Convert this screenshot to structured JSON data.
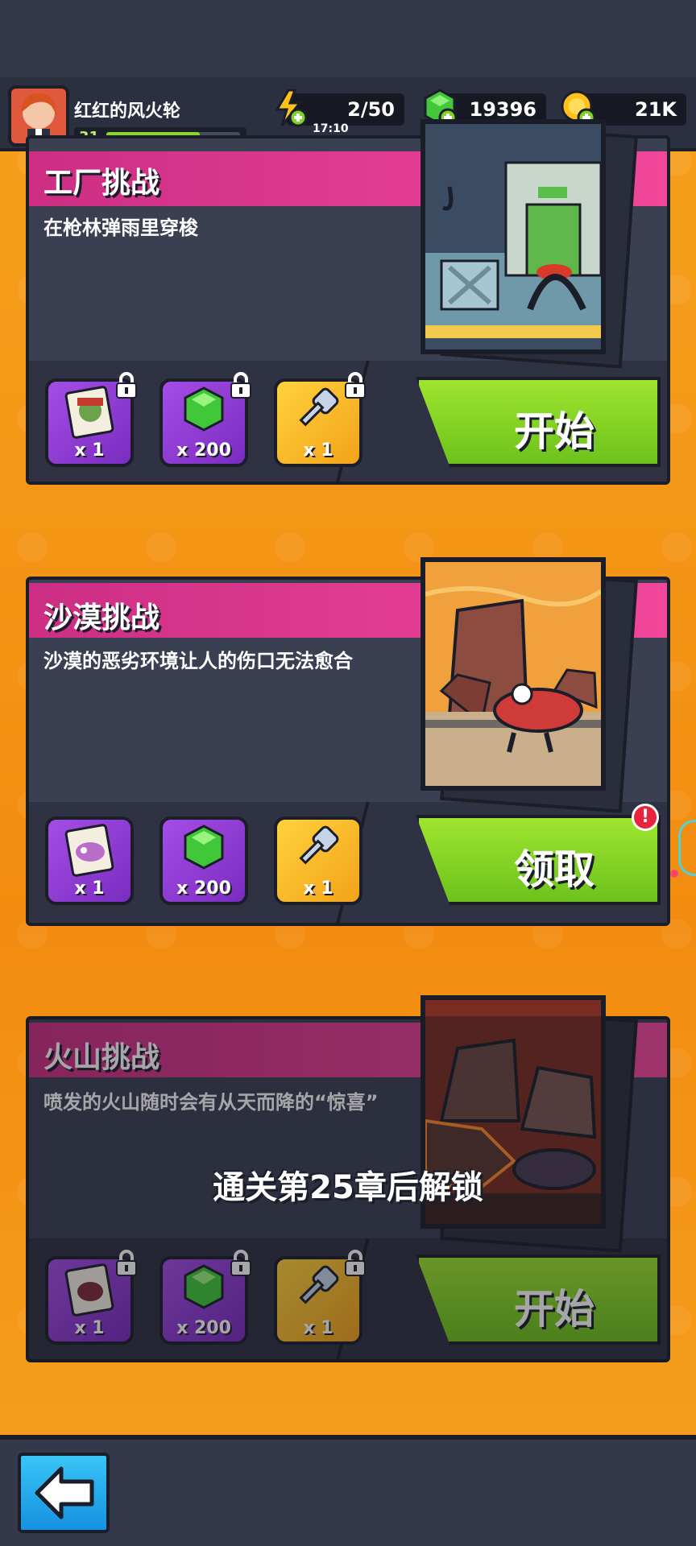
{
  "hud": {
    "player_name": "红红的风火轮",
    "level": "31",
    "xp_fraction": 0.7,
    "energy": "2/50",
    "energy_timer": "17:10",
    "gems": "19396",
    "coins": "21K"
  },
  "challenges": [
    {
      "title": "工厂挑战",
      "description": "在枪林弹雨里穿梭",
      "rewards": [
        {
          "icon": "zombie-card-icon",
          "qty": "x 1",
          "locked": true
        },
        {
          "icon": "green-gem-icon",
          "qty": "x 200",
          "locked": true
        },
        {
          "icon": "key-icon",
          "qty": "x 1",
          "locked": true
        }
      ],
      "button_label": "开始"
    },
    {
      "title": "沙漠挑战",
      "description": "沙漠的恶劣环境让人的伤口无法愈合",
      "rewards": [
        {
          "icon": "zombie-card-icon",
          "qty": "x 1",
          "locked": false
        },
        {
          "icon": "green-gem-icon",
          "qty": "x 200",
          "locked": false
        },
        {
          "icon": "key-icon",
          "qty": "x 1",
          "locked": false
        }
      ],
      "button_label": "领取",
      "alert": "!"
    },
    {
      "title": "火山挑战",
      "description": "喷发的火山随时会有从天而降的“惊喜”",
      "rewards": [
        {
          "icon": "zombie-card-icon",
          "qty": "x 1",
          "locked": true
        },
        {
          "icon": "green-gem-icon",
          "qty": "x 200",
          "locked": true
        },
        {
          "icon": "key-icon",
          "qty": "x 1",
          "locked": true
        }
      ],
      "button_label": "开始",
      "unlock_hint": "通关第25章后解锁"
    }
  ],
  "colors": {
    "background": "#f59a1a",
    "card": "#3a3f52",
    "header_pink": "#f1479b",
    "cta_green": "#8ad62a",
    "back_blue": "#2aa8ee"
  }
}
